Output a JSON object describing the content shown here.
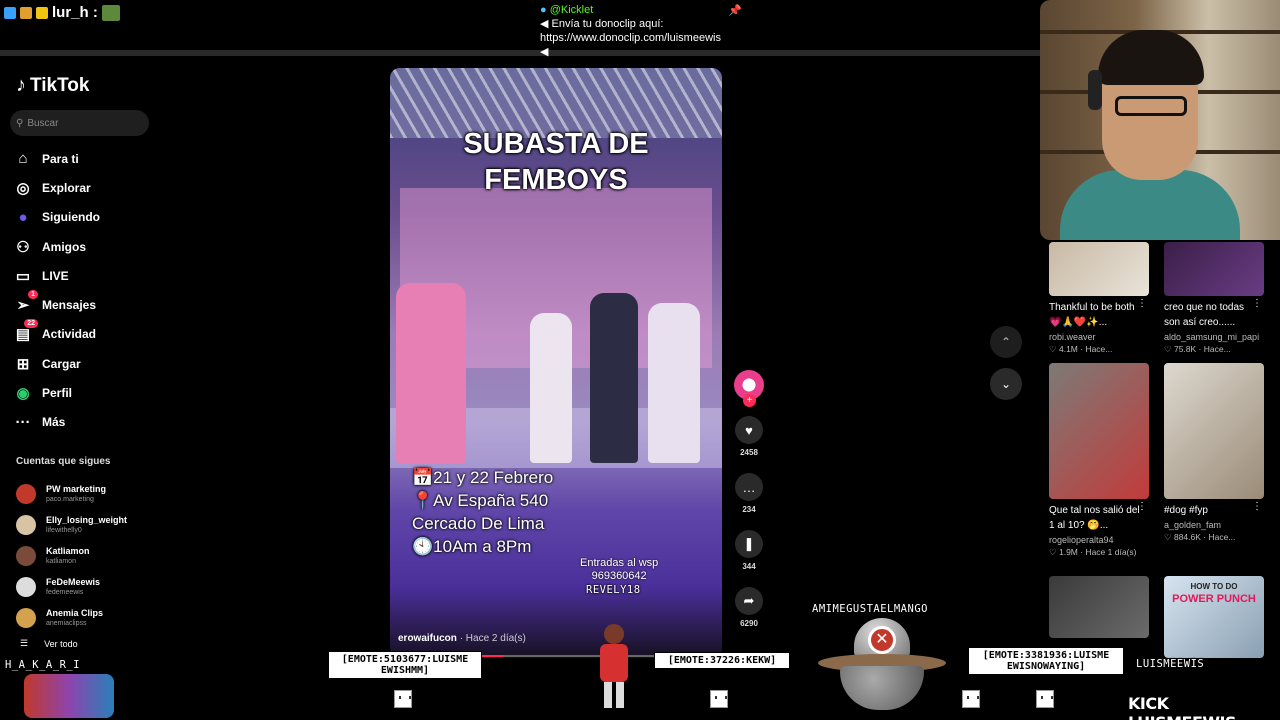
{
  "stream_overlay": {
    "chat_user": "lur_h :",
    "kick_channel": "@Kicklet",
    "kick_message_line1": "Envía tu donoclip aquí:",
    "kick_message_line2": "https://www.donoclip.com/luismeewis"
  },
  "tiktok": {
    "logo": "TikTok",
    "search_placeholder": "Buscar",
    "nav": [
      {
        "label": "Para ti",
        "icon": "home-icon"
      },
      {
        "label": "Explorar",
        "icon": "compass-icon"
      },
      {
        "label": "Siguiendo",
        "icon": "following-avatar-icon"
      },
      {
        "label": "Amigos",
        "icon": "friends-icon"
      },
      {
        "label": "LIVE",
        "icon": "live-icon"
      },
      {
        "label": "Mensajes",
        "icon": "messages-icon",
        "badge": "1"
      },
      {
        "label": "Actividad",
        "icon": "activity-icon",
        "badge": "22"
      },
      {
        "label": "Cargar",
        "icon": "upload-icon"
      },
      {
        "label": "Perfil",
        "icon": "profile-icon"
      },
      {
        "label": "Más",
        "icon": "more-icon"
      }
    ],
    "following_title": "Cuentas que sigues",
    "following": [
      {
        "name": "PW marketing",
        "handle": "paco.marketing",
        "color": "#c0392b"
      },
      {
        "name": "Elly_losing_weight",
        "handle": "lifewithelly0",
        "color": "#d8c3a5"
      },
      {
        "name": "Katliamon",
        "handle": "katliamon",
        "color": "#7a4a3a"
      },
      {
        "name": "FeDeMeewis",
        "handle": "fedemeewis",
        "color": "#dddddd"
      },
      {
        "name": "Anemia Clips",
        "handle": "anemiaclipss",
        "color": "#d4a24c"
      }
    ],
    "ver_todo": "Ver todo"
  },
  "video": {
    "title_line1": "SUBASTA DE",
    "title_line2": "FEMBOYS",
    "info_lines": [
      "📅21 y 22 Febrero",
      "📍Av España 540",
      "Cercado De Lima",
      "🕙10Am a 8Pm"
    ],
    "entradas_line1": "Entradas al wsp",
    "entradas_line2": "969360642",
    "author": "erowaifucon",
    "posted": "· Hace 2 día(s)",
    "progress_fraction": 0.1,
    "actions": [
      {
        "icon": "heart-icon",
        "glyph": "♥",
        "count": "2458"
      },
      {
        "icon": "comment-icon",
        "glyph": "…",
        "count": "234"
      },
      {
        "icon": "bookmark-icon",
        "glyph": "❚",
        "count": "344"
      },
      {
        "icon": "share-icon",
        "glyph": "➦",
        "count": "6290"
      }
    ]
  },
  "suggestions": [
    {
      "title": "Thankful to be both 💗🙏❤️✨...",
      "author": "robi.weaver",
      "meta": "♡ 4.1M · Hace...",
      "colors": [
        "#c8b9a4",
        "#e9e3d9"
      ]
    },
    {
      "title": "creo que no todas son así creo......",
      "author": "aldo_samsung_mi_papi",
      "meta": "♡ 75.8K · Hace...",
      "colors": [
        "#3a1f48",
        "#6a3c84"
      ]
    },
    {
      "title": "Que tal nos salió del 1 al 10? 🤭...",
      "author": "rogelioperalta94",
      "meta": "♡ 1.9M · Hace 1 día(s)",
      "colors": [
        "#7d7a76",
        "#c23b3b"
      ]
    },
    {
      "title": "#dog #fyp",
      "author": "a_golden_fam",
      "meta": "♡ 884.6K · Hace...",
      "colors": [
        "#ddd8cf",
        "#9a8b77"
      ]
    },
    {
      "title": "",
      "author": "",
      "meta": "",
      "colors": [
        "#3a3a3a",
        "#6b6b6b"
      ]
    },
    {
      "title": "",
      "author": "",
      "meta": "",
      "caption_line1": "HOW TO DO",
      "caption_line2": "POWER PUNCH",
      "colors": [
        "#d6e4ef",
        "#8a9fb3"
      ]
    }
  ],
  "chat_bottom": {
    "emote1": "[EMOTE:5103677:LUISME EWISHMM]",
    "emote2": "[EMOTE:37226:KEKW]",
    "emote3": "[EMOTE:3381936:LUISME EWISNOWAYING]",
    "name_reverly": "REVELY18",
    "name_mango": "AMIMEGUSTAELMANGO",
    "name_harari": "H_A_K_A_R_I",
    "name_luis": "LUISMEEWIS",
    "kick_logo": "KICK LUISMEEWIS"
  }
}
